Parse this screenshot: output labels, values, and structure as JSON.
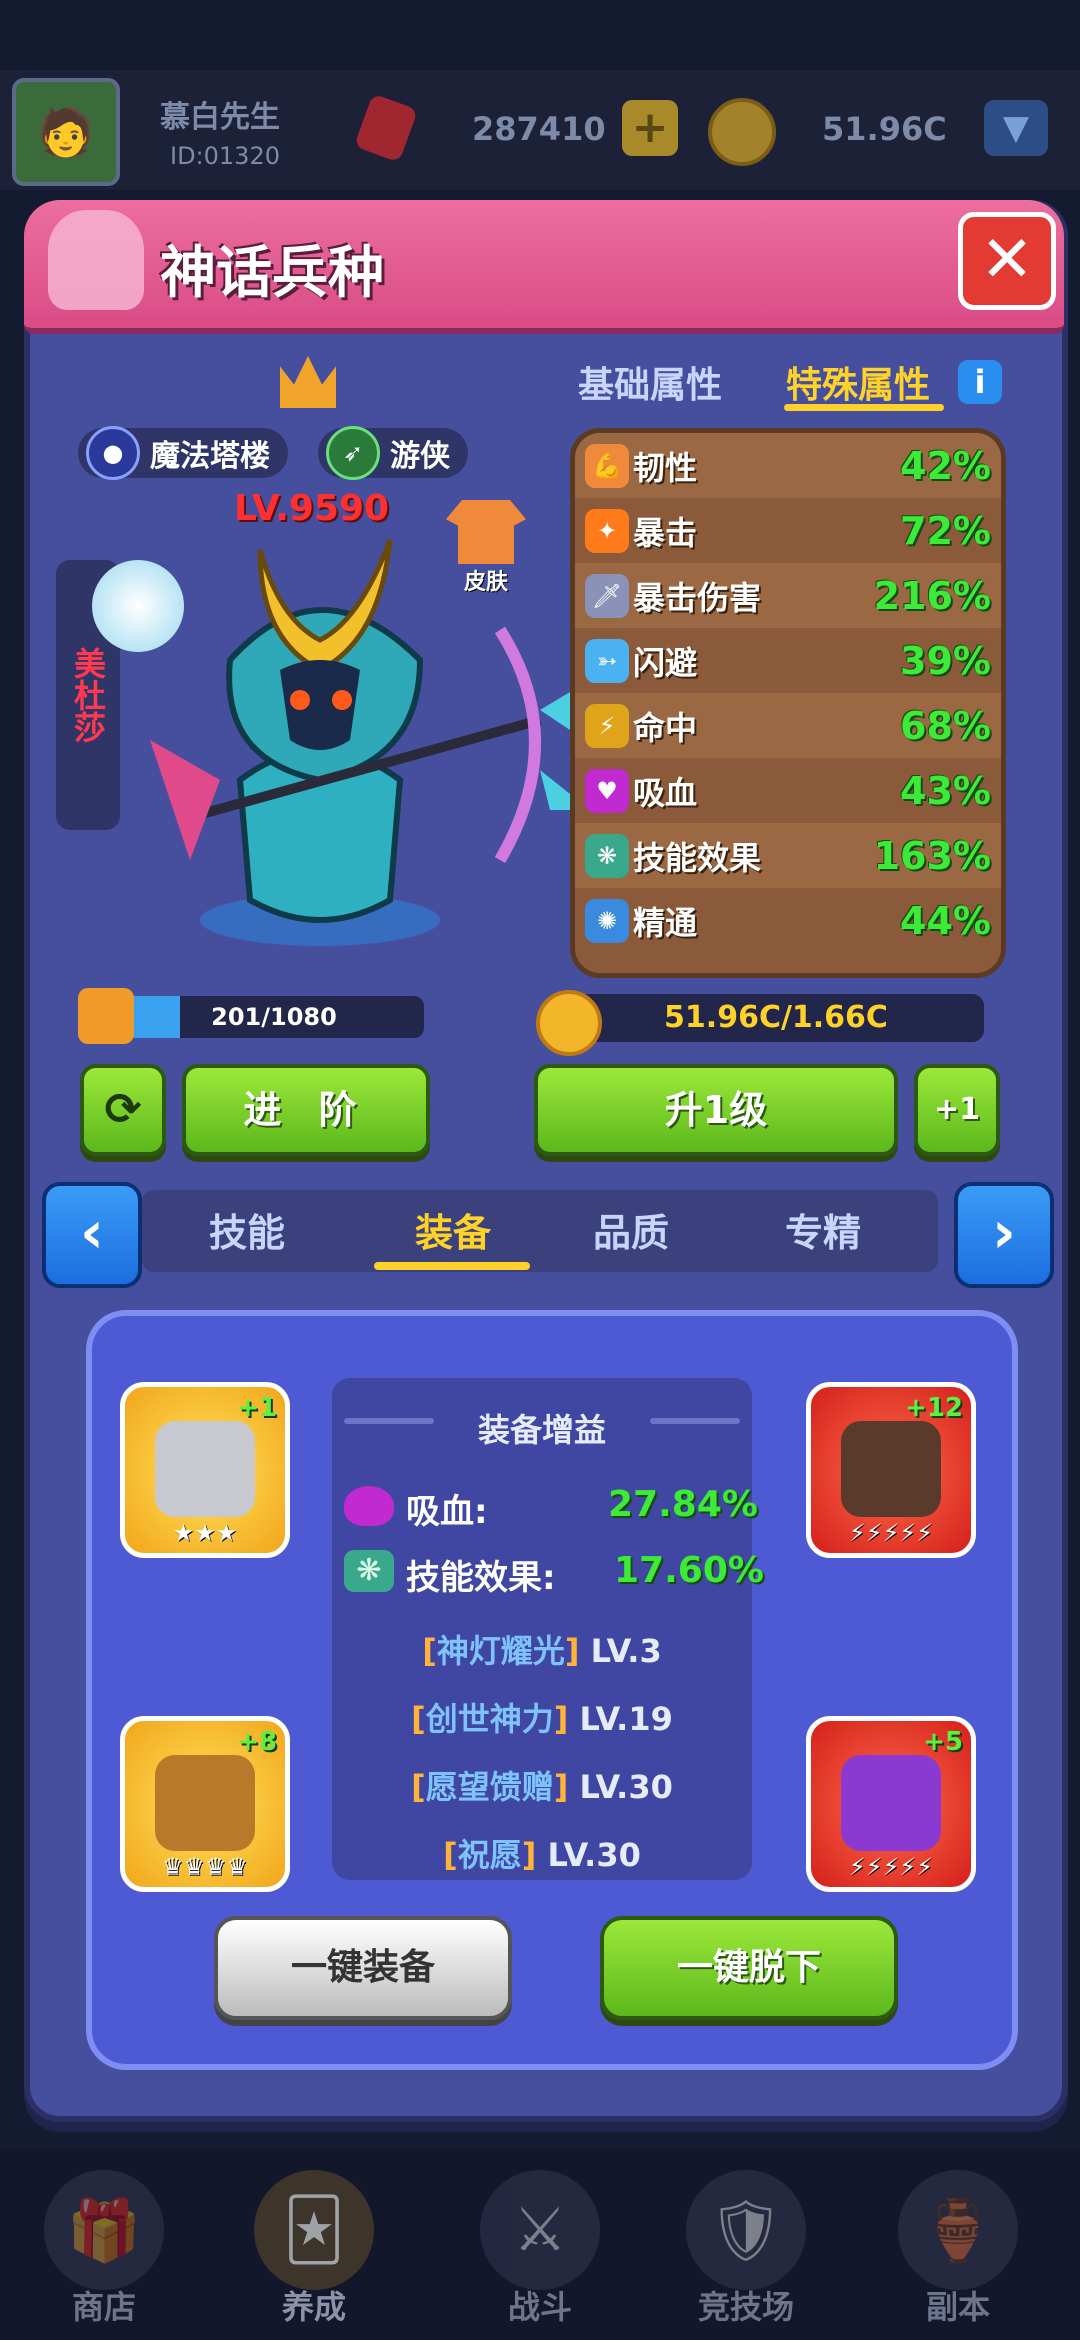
{
  "player": {
    "name": "慕白先生",
    "id": "ID:01320",
    "gems": "287410",
    "gold": "51.96C"
  },
  "panel": {
    "title": "神话兵种"
  },
  "hero": {
    "level": "LV.9590",
    "name": "美杜莎",
    "tags": [
      {
        "label": "魔法塔楼",
        "icon": "magic-orb-icon"
      },
      {
        "label": "游侠",
        "icon": "bow-icon"
      }
    ],
    "skin_label": "皮肤"
  },
  "attr_tabs": {
    "basic": "基础属性",
    "special": "特殊属性",
    "active": "special"
  },
  "attributes": [
    {
      "name": "韧性",
      "value": "42%",
      "icon": "muscle-icon",
      "color": "#f08a3a"
    },
    {
      "name": "暴击",
      "value": "72%",
      "icon": "crit-icon",
      "color": "#ff7a1a"
    },
    {
      "name": "暴击伤害",
      "value": "216%",
      "icon": "sword-icon",
      "color": "#c0c8e8"
    },
    {
      "name": "闪避",
      "value": "39%",
      "icon": "dodge-icon",
      "color": "#4ab2f0"
    },
    {
      "name": "命中",
      "value": "68%",
      "icon": "lightning-icon",
      "color": "#ffd22a"
    },
    {
      "name": "吸血",
      "value": "43%",
      "icon": "lips-icon",
      "color": "#c02ad0"
    },
    {
      "name": "技能效果",
      "value": "163%",
      "icon": "skill-icon",
      "color": "#6ee0c0"
    },
    {
      "name": "精通",
      "value": "44%",
      "icon": "mastery-icon",
      "color": "#3a8ae0"
    }
  ],
  "progress": {
    "fragments": "201/1080",
    "fraction": 0.186,
    "gold_cost": "51.96C/1.66C"
  },
  "actions": {
    "advance": "进 阶",
    "upgrade": "升1级",
    "plus_one": "+1"
  },
  "section_tabs": {
    "items": [
      "技能",
      "装备",
      "品质",
      "专精"
    ],
    "active": 1
  },
  "equipment": {
    "slots": [
      {
        "level": "+1",
        "stars": "★★★",
        "icon": "helmet-icon"
      },
      {
        "level": "+12",
        "stars": "⚡⚡⚡⚡⚡",
        "icon": "chest-icon"
      },
      {
        "level": "+8",
        "stars": "♛♛♛♛",
        "icon": "crossbow-icon"
      },
      {
        "level": "+5",
        "stars": "⚡⚡⚡⚡⚡",
        "icon": "gem-crest-icon"
      }
    ],
    "bonus_title": "装备增益",
    "bonuses": [
      {
        "name": "吸血:",
        "value": "27.84%"
      },
      {
        "name": "技能效果:",
        "value": "17.60%"
      }
    ],
    "skills": [
      {
        "name": "神灯耀光",
        "level": "LV.3"
      },
      {
        "name": "创世神力",
        "level": "LV.19"
      },
      {
        "name": "愿望馈赠",
        "level": "LV.30"
      },
      {
        "name": "祝愿",
        "level": "LV.30"
      }
    ],
    "equip_all": "一键装备",
    "unequip_all": "一键脱下"
  },
  "bottom_nav": [
    {
      "label": "商店",
      "icon": "shop-icon"
    },
    {
      "label": "养成",
      "icon": "card-icon"
    },
    {
      "label": "战斗",
      "icon": "swords-icon"
    },
    {
      "label": "竞技场",
      "icon": "arena-icon"
    },
    {
      "label": "副本",
      "icon": "dungeon-icon"
    }
  ]
}
